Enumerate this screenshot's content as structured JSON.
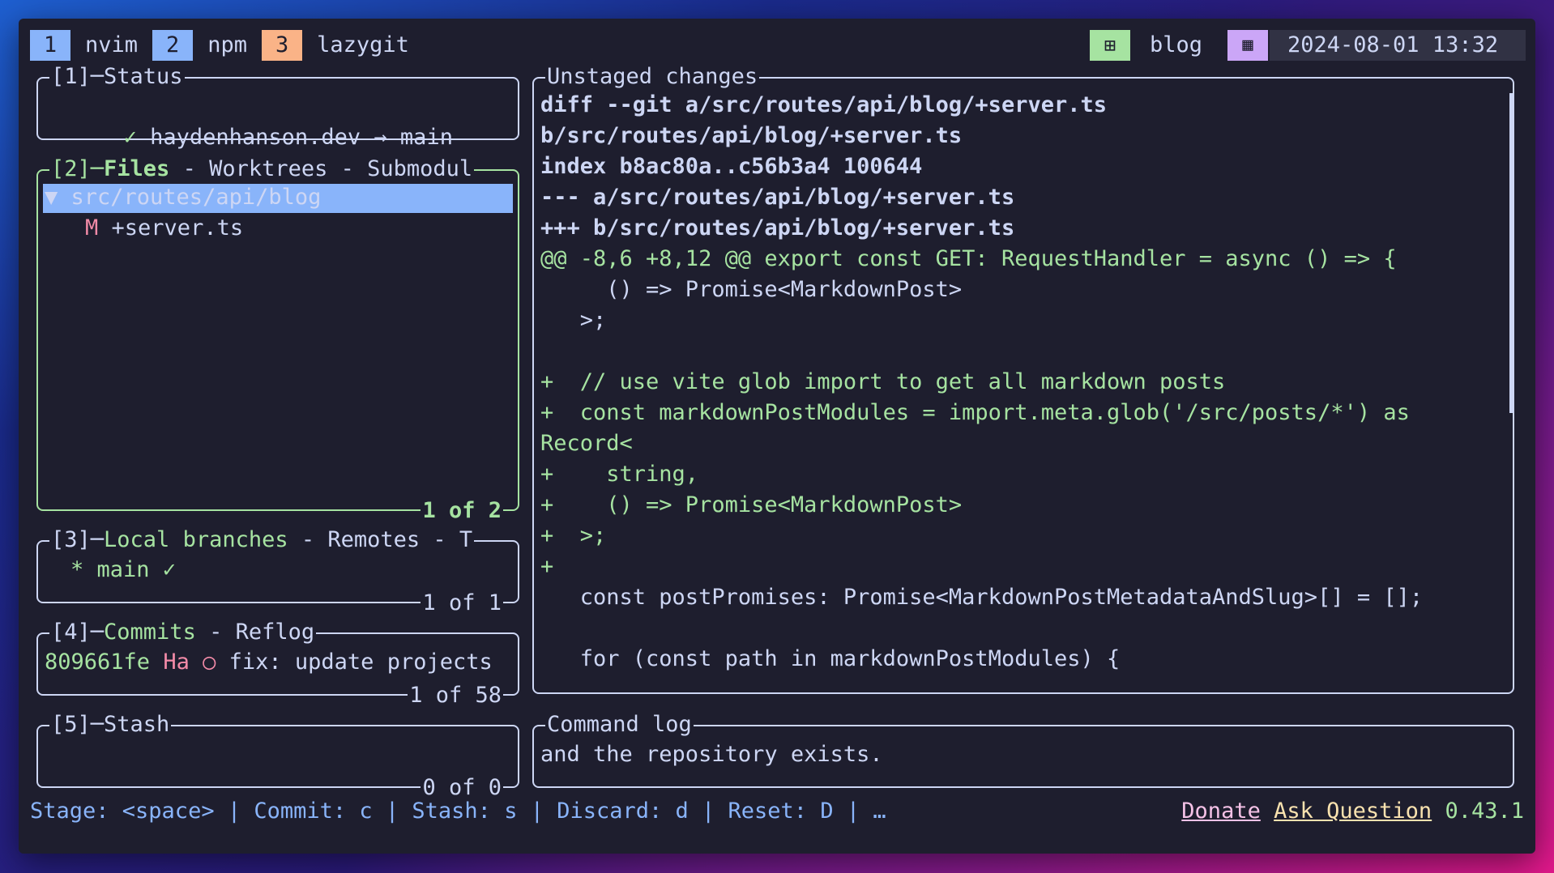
{
  "tabs": [
    {
      "num": "1",
      "label": "nvim",
      "color": "#89b4fa"
    },
    {
      "num": "2",
      "label": "npm",
      "color": "#89b4fa"
    },
    {
      "num": "3",
      "label": "lazygit",
      "color": "#fab387"
    }
  ],
  "session": {
    "icon": "layout-icon",
    "name": "blog",
    "icon_color": "#a6e3a1"
  },
  "clock": {
    "icon": "calendar-icon",
    "datetime": "2024-08-01 13:32",
    "icon_color": "#cba6f7"
  },
  "status": {
    "title": "[1]─Status",
    "check": "✓",
    "text": "haydenhanson.dev → main"
  },
  "files": {
    "num": "[2]─",
    "tabs_active": "Files",
    "tabs_rest": " - Worktrees - Submodul",
    "dir": "▼ src/routes/api/blog",
    "file_status": "M",
    "file_name": "+server.ts",
    "counter": "1 of 2"
  },
  "branches": {
    "num": "[3]─",
    "tabs_active": "Local branches",
    "tabs_rest": " - Remotes - T",
    "branch": "* main ✓",
    "counter": "1 of 1"
  },
  "commits": {
    "num": "[4]─",
    "tabs_active": "Commits",
    "tabs_rest": " - Reflog",
    "hash": "809661fe",
    "author": "Ha",
    "marker": "○",
    "message": "fix: update projects",
    "counter": "1 of 58"
  },
  "stash": {
    "title": "[5]─Stash",
    "counter": "0 of 0"
  },
  "diff": {
    "title": "Unstaged changes",
    "lines": [
      {
        "text": "diff --git a/src/routes/api/blog/+server.ts",
        "style": "bold"
      },
      {
        "text": "b/src/routes/api/blog/+server.ts",
        "style": "bold"
      },
      {
        "text": "index b8ac80a..c56b3a4 100644",
        "style": "bold"
      },
      {
        "text": "--- a/src/routes/api/blog/+server.ts",
        "style": "bold"
      },
      {
        "text": "+++ b/src/routes/api/blog/+server.ts",
        "style": "bold"
      },
      {
        "text": "@@ -8,6 +8,12 @@ export const GET: RequestHandler = async () => {",
        "style": "hunk"
      },
      {
        "text": "     () => Promise<MarkdownPost>",
        "style": "plain"
      },
      {
        "text": "   >;",
        "style": "plain"
      },
      {
        "text": "",
        "style": "plain"
      },
      {
        "text": "+  // use vite glob import to get all markdown posts",
        "style": "add"
      },
      {
        "text": "+  const markdownPostModules = import.meta.glob('/src/posts/*') as",
        "style": "add"
      },
      {
        "text": "Record<",
        "style": "add"
      },
      {
        "text": "+    string,",
        "style": "add"
      },
      {
        "text": "+    () => Promise<MarkdownPost>",
        "style": "add"
      },
      {
        "text": "+  >;",
        "style": "add"
      },
      {
        "text": "+",
        "style": "add"
      },
      {
        "text": "   const postPromises: Promise<MarkdownPostMetadataAndSlug>[] = [];",
        "style": "plain"
      },
      {
        "text": "",
        "style": "plain"
      },
      {
        "text": "   for (const path in markdownPostModules) {",
        "style": "plain"
      }
    ]
  },
  "command_log": {
    "title": "Command log",
    "text": "and the repository exists."
  },
  "footer": {
    "keys": "Stage: <space> | Commit: c | Stash: s | Discard: d | Reset: D | …",
    "donate": "Donate",
    "ask": "Ask Question",
    "version": "0.43.1"
  }
}
